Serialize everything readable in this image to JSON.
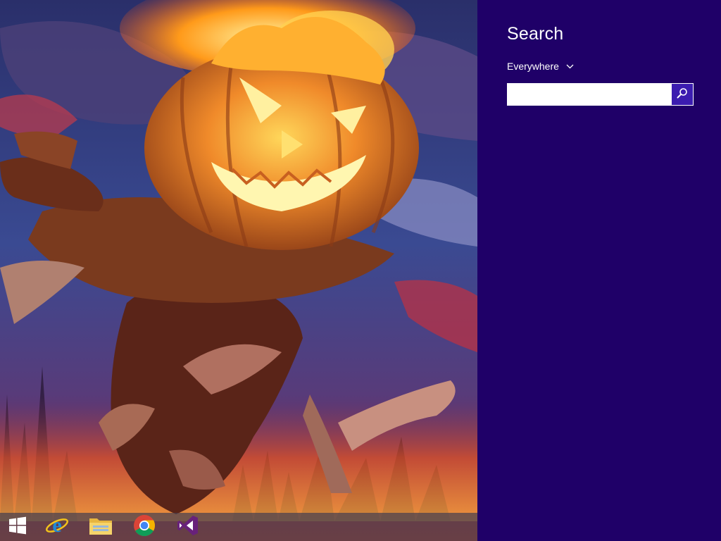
{
  "charm": {
    "title": "Search",
    "scope_label": "Everywhere",
    "search": {
      "value": "",
      "placeholder": ""
    }
  },
  "icons": {
    "scope_chevron": "chevron-down-icon",
    "search_button": "magnifier-icon"
  },
  "taskbar": {
    "items": [
      {
        "name": "start",
        "icon": "windows-logo-icon"
      },
      {
        "name": "internet-explorer",
        "icon": "internet-explorer-icon"
      },
      {
        "name": "file-explorer",
        "icon": "folder-icon"
      },
      {
        "name": "chrome",
        "icon": "chrome-icon"
      },
      {
        "name": "visual-studio",
        "icon": "visual-studio-icon"
      }
    ]
  },
  "colors": {
    "charm_background": "#1f0068",
    "search_button": "#3b1cb0",
    "taskbar": "#463e50"
  }
}
